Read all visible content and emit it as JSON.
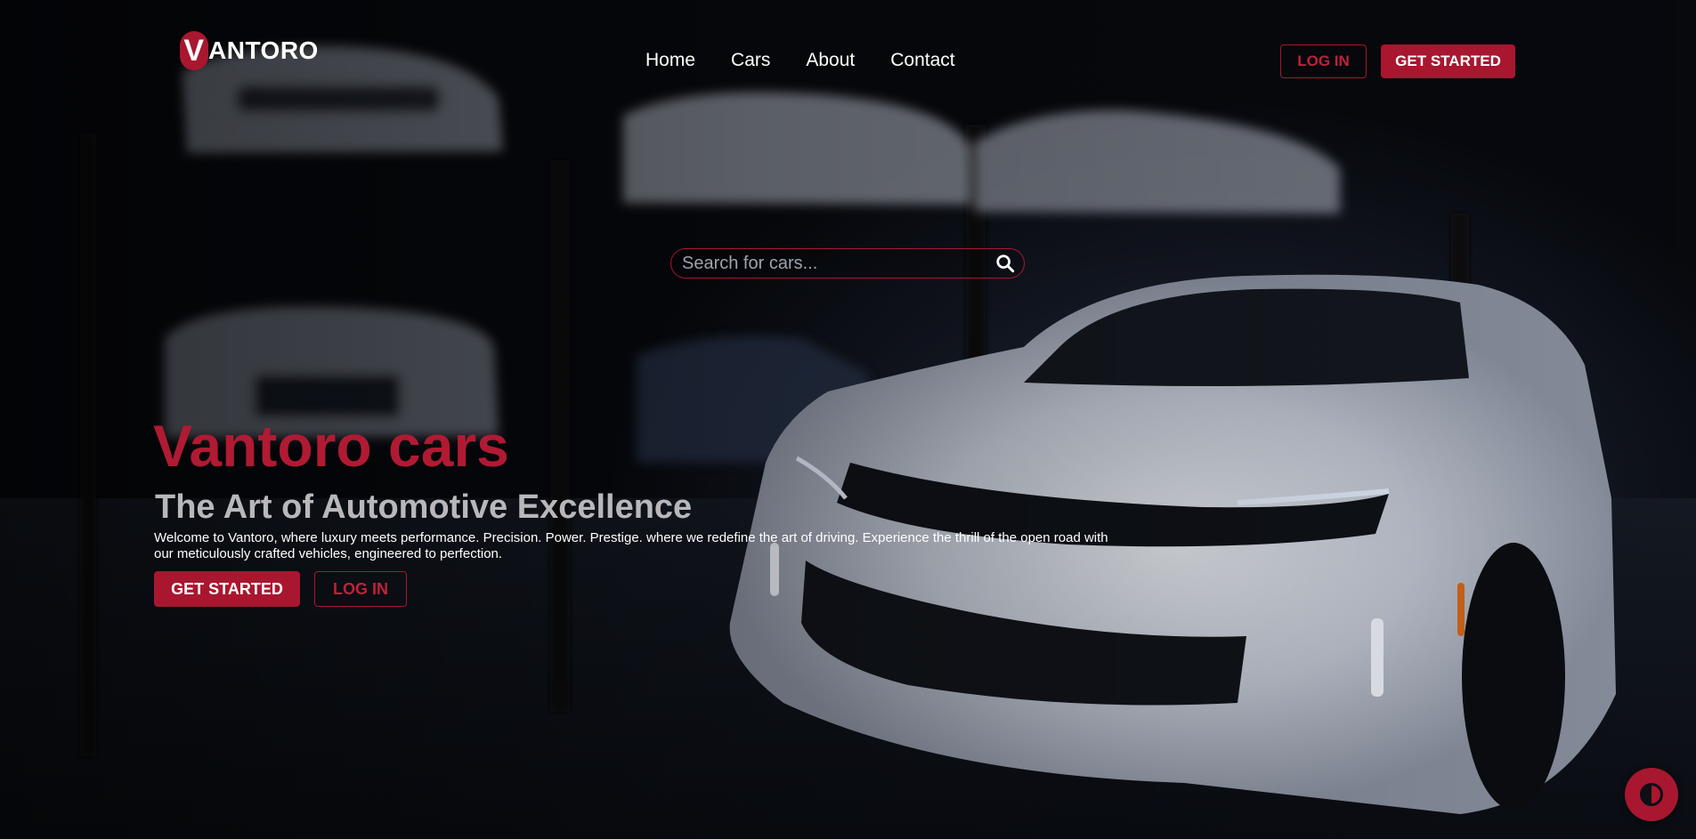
{
  "brand": {
    "logo_initial": "V",
    "logo_rest": "ANTORO",
    "accent_color": "#a8172f"
  },
  "nav": {
    "items": [
      {
        "label": "Home"
      },
      {
        "label": "Cars"
      },
      {
        "label": "About"
      },
      {
        "label": "Contact"
      }
    ]
  },
  "header_actions": {
    "login_label": "LOG IN",
    "get_started_label": "GET STARTED"
  },
  "search": {
    "placeholder": "Search for cars...",
    "value": "",
    "icon": "search-icon"
  },
  "hero": {
    "title": "Vantoro cars",
    "subtitle": "The Art of Automotive Excellence",
    "description": "Welcome to Vantoro, where luxury meets performance. Precision. Power. Prestige. where we redefine the art of driving. Experience the thrill of the open road with our meticulously crafted vehicles, engineered to perfection.",
    "primary_button": "GET STARTED",
    "secondary_button": "LOG IN"
  },
  "theme_toggle": {
    "icon": "contrast-icon"
  }
}
